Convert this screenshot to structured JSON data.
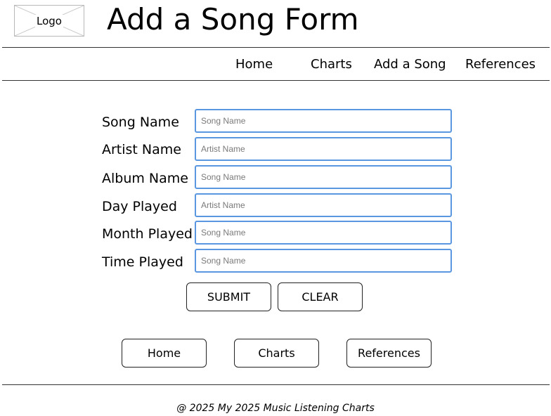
{
  "header": {
    "logo_label": "Logo",
    "title": "Add a Song Form"
  },
  "nav": {
    "items": [
      {
        "label": "Home"
      },
      {
        "label": "Charts"
      },
      {
        "label": "Add a Song"
      },
      {
        "label": "References"
      }
    ]
  },
  "form": {
    "fields": [
      {
        "label": "Song Name",
        "placeholder": "Song Name",
        "value": ""
      },
      {
        "label": "Artist Name",
        "placeholder": "Artist Name",
        "value": ""
      },
      {
        "label": "Album Name",
        "placeholder": "Song Name",
        "value": ""
      },
      {
        "label": "Day Played",
        "placeholder": "Artist Name",
        "value": ""
      },
      {
        "label": "Month Played",
        "placeholder": "Song Name",
        "value": ""
      },
      {
        "label": "Time Played",
        "placeholder": "Song Name",
        "value": ""
      }
    ],
    "submit_label": "SUBMIT",
    "clear_label": "CLEAR"
  },
  "bottom_nav": {
    "items": [
      {
        "label": "Home"
      },
      {
        "label": "Charts"
      },
      {
        "label": "References"
      }
    ]
  },
  "footer": {
    "text": "@ 2025 My 2025 Music Listening Charts"
  },
  "colors": {
    "input_border": "#5b97e0",
    "rule": "#333333",
    "logo_border": "#b8b8b8"
  }
}
